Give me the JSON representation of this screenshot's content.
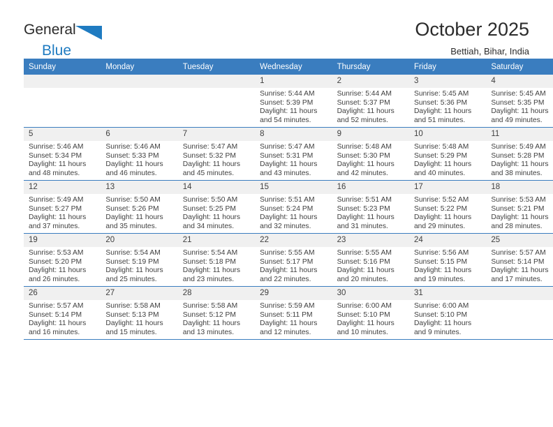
{
  "brand": {
    "name_top": "General",
    "name_bottom": "Blue",
    "triangle_color": "#1f7bc1"
  },
  "header": {
    "title": "October 2025",
    "location": "Bettiah, Bihar, India"
  },
  "theme": {
    "header_blue": "#3a7dbf",
    "daynum_bg": "#f0f0f0",
    "text": "#3f3f3f"
  },
  "calendar": {
    "weekday_headers": [
      "Sunday",
      "Monday",
      "Tuesday",
      "Wednesday",
      "Thursday",
      "Friday",
      "Saturday"
    ],
    "labels": {
      "sunrise": "Sunrise:",
      "sunset": "Sunset:",
      "daylight": "Daylight:"
    },
    "weeks": [
      [
        {
          "day": "",
          "empty": true
        },
        {
          "day": "",
          "empty": true
        },
        {
          "day": "",
          "empty": true
        },
        {
          "day": "1",
          "sunrise": "Sunrise: 5:44 AM",
          "sunset": "Sunset: 5:39 PM",
          "daylight_1": "Daylight: 11 hours",
          "daylight_2": "and 54 minutes."
        },
        {
          "day": "2",
          "sunrise": "Sunrise: 5:44 AM",
          "sunset": "Sunset: 5:37 PM",
          "daylight_1": "Daylight: 11 hours",
          "daylight_2": "and 52 minutes."
        },
        {
          "day": "3",
          "sunrise": "Sunrise: 5:45 AM",
          "sunset": "Sunset: 5:36 PM",
          "daylight_1": "Daylight: 11 hours",
          "daylight_2": "and 51 minutes."
        },
        {
          "day": "4",
          "sunrise": "Sunrise: 5:45 AM",
          "sunset": "Sunset: 5:35 PM",
          "daylight_1": "Daylight: 11 hours",
          "daylight_2": "and 49 minutes."
        }
      ],
      [
        {
          "day": "5",
          "sunrise": "Sunrise: 5:46 AM",
          "sunset": "Sunset: 5:34 PM",
          "daylight_1": "Daylight: 11 hours",
          "daylight_2": "and 48 minutes."
        },
        {
          "day": "6",
          "sunrise": "Sunrise: 5:46 AM",
          "sunset": "Sunset: 5:33 PM",
          "daylight_1": "Daylight: 11 hours",
          "daylight_2": "and 46 minutes."
        },
        {
          "day": "7",
          "sunrise": "Sunrise: 5:47 AM",
          "sunset": "Sunset: 5:32 PM",
          "daylight_1": "Daylight: 11 hours",
          "daylight_2": "and 45 minutes."
        },
        {
          "day": "8",
          "sunrise": "Sunrise: 5:47 AM",
          "sunset": "Sunset: 5:31 PM",
          "daylight_1": "Daylight: 11 hours",
          "daylight_2": "and 43 minutes."
        },
        {
          "day": "9",
          "sunrise": "Sunrise: 5:48 AM",
          "sunset": "Sunset: 5:30 PM",
          "daylight_1": "Daylight: 11 hours",
          "daylight_2": "and 42 minutes."
        },
        {
          "day": "10",
          "sunrise": "Sunrise: 5:48 AM",
          "sunset": "Sunset: 5:29 PM",
          "daylight_1": "Daylight: 11 hours",
          "daylight_2": "and 40 minutes."
        },
        {
          "day": "11",
          "sunrise": "Sunrise: 5:49 AM",
          "sunset": "Sunset: 5:28 PM",
          "daylight_1": "Daylight: 11 hours",
          "daylight_2": "and 38 minutes."
        }
      ],
      [
        {
          "day": "12",
          "sunrise": "Sunrise: 5:49 AM",
          "sunset": "Sunset: 5:27 PM",
          "daylight_1": "Daylight: 11 hours",
          "daylight_2": "and 37 minutes."
        },
        {
          "day": "13",
          "sunrise": "Sunrise: 5:50 AM",
          "sunset": "Sunset: 5:26 PM",
          "daylight_1": "Daylight: 11 hours",
          "daylight_2": "and 35 minutes."
        },
        {
          "day": "14",
          "sunrise": "Sunrise: 5:50 AM",
          "sunset": "Sunset: 5:25 PM",
          "daylight_1": "Daylight: 11 hours",
          "daylight_2": "and 34 minutes."
        },
        {
          "day": "15",
          "sunrise": "Sunrise: 5:51 AM",
          "sunset": "Sunset: 5:24 PM",
          "daylight_1": "Daylight: 11 hours",
          "daylight_2": "and 32 minutes."
        },
        {
          "day": "16",
          "sunrise": "Sunrise: 5:51 AM",
          "sunset": "Sunset: 5:23 PM",
          "daylight_1": "Daylight: 11 hours",
          "daylight_2": "and 31 minutes."
        },
        {
          "day": "17",
          "sunrise": "Sunrise: 5:52 AM",
          "sunset": "Sunset: 5:22 PM",
          "daylight_1": "Daylight: 11 hours",
          "daylight_2": "and 29 minutes."
        },
        {
          "day": "18",
          "sunrise": "Sunrise: 5:53 AM",
          "sunset": "Sunset: 5:21 PM",
          "daylight_1": "Daylight: 11 hours",
          "daylight_2": "and 28 minutes."
        }
      ],
      [
        {
          "day": "19",
          "sunrise": "Sunrise: 5:53 AM",
          "sunset": "Sunset: 5:20 PM",
          "daylight_1": "Daylight: 11 hours",
          "daylight_2": "and 26 minutes."
        },
        {
          "day": "20",
          "sunrise": "Sunrise: 5:54 AM",
          "sunset": "Sunset: 5:19 PM",
          "daylight_1": "Daylight: 11 hours",
          "daylight_2": "and 25 minutes."
        },
        {
          "day": "21",
          "sunrise": "Sunrise: 5:54 AM",
          "sunset": "Sunset: 5:18 PM",
          "daylight_1": "Daylight: 11 hours",
          "daylight_2": "and 23 minutes."
        },
        {
          "day": "22",
          "sunrise": "Sunrise: 5:55 AM",
          "sunset": "Sunset: 5:17 PM",
          "daylight_1": "Daylight: 11 hours",
          "daylight_2": "and 22 minutes."
        },
        {
          "day": "23",
          "sunrise": "Sunrise: 5:55 AM",
          "sunset": "Sunset: 5:16 PM",
          "daylight_1": "Daylight: 11 hours",
          "daylight_2": "and 20 minutes."
        },
        {
          "day": "24",
          "sunrise": "Sunrise: 5:56 AM",
          "sunset": "Sunset: 5:15 PM",
          "daylight_1": "Daylight: 11 hours",
          "daylight_2": "and 19 minutes."
        },
        {
          "day": "25",
          "sunrise": "Sunrise: 5:57 AM",
          "sunset": "Sunset: 5:14 PM",
          "daylight_1": "Daylight: 11 hours",
          "daylight_2": "and 17 minutes."
        }
      ],
      [
        {
          "day": "26",
          "sunrise": "Sunrise: 5:57 AM",
          "sunset": "Sunset: 5:14 PM",
          "daylight_1": "Daylight: 11 hours",
          "daylight_2": "and 16 minutes."
        },
        {
          "day": "27",
          "sunrise": "Sunrise: 5:58 AM",
          "sunset": "Sunset: 5:13 PM",
          "daylight_1": "Daylight: 11 hours",
          "daylight_2": "and 15 minutes."
        },
        {
          "day": "28",
          "sunrise": "Sunrise: 5:58 AM",
          "sunset": "Sunset: 5:12 PM",
          "daylight_1": "Daylight: 11 hours",
          "daylight_2": "and 13 minutes."
        },
        {
          "day": "29",
          "sunrise": "Sunrise: 5:59 AM",
          "sunset": "Sunset: 5:11 PM",
          "daylight_1": "Daylight: 11 hours",
          "daylight_2": "and 12 minutes."
        },
        {
          "day": "30",
          "sunrise": "Sunrise: 6:00 AM",
          "sunset": "Sunset: 5:10 PM",
          "daylight_1": "Daylight: 11 hours",
          "daylight_2": "and 10 minutes."
        },
        {
          "day": "31",
          "sunrise": "Sunrise: 6:00 AM",
          "sunset": "Sunset: 5:10 PM",
          "daylight_1": "Daylight: 11 hours",
          "daylight_2": "and 9 minutes."
        },
        {
          "day": "",
          "empty": true
        }
      ]
    ]
  }
}
